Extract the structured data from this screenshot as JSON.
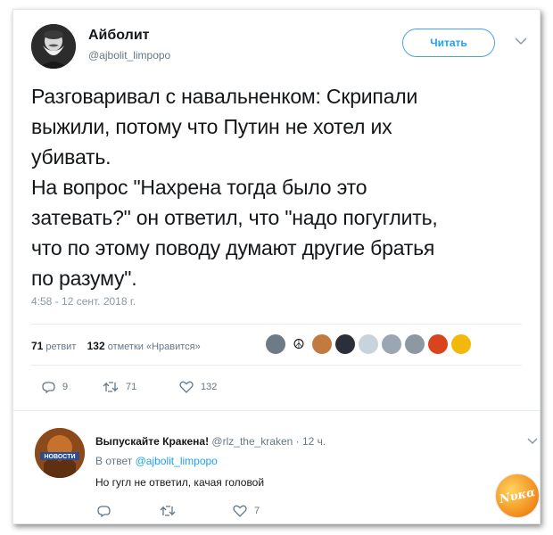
{
  "tweet": {
    "author_name": "Айболит",
    "author_handle": "@ajbolit_limpopo",
    "follow_label": "Читать",
    "text": "Разговаривал с навальненком: Скрипали\nвыжили, потому что Путин не хотел их\nубивать.\nНа вопрос \"Нахрена тогда было это\nзатевать?\" он ответил, что \"надо погуглить,\nчто по этому поводу думают другие братья\nпо разуму\".",
    "timestamp": "4:58 - 12 сент. 2018 г.",
    "retweets_count": "71",
    "retweets_label": "ретвит",
    "likes_count": "132",
    "likes_label": "отметки «Нравится»",
    "reply_action_count": "9",
    "retweet_action_count": "71",
    "like_action_count": "132",
    "liker_colors": [
      "#6d7b86",
      "#111111",
      "#c27a3e",
      "#2b2f3a",
      "#c9d3dc",
      "#9aa7b3",
      "#8d98a3",
      "#d9431e",
      "#f2b90c"
    ]
  },
  "reply": {
    "author_name": "Выпускайте Кракена!",
    "author_handle": "@rlz_the_kraken",
    "time": "· 12 ч.",
    "reply_to_prefix": "В ответ",
    "reply_to_handle": "@ajbolit_limpopo",
    "text": "Но гугл не ответил, качая головой",
    "reply_action_count": "",
    "retweet_action_count": "",
    "like_action_count": "7",
    "avatar_label": "НОВОСТИ"
  },
  "watermark": {
    "text": "Νυκα"
  },
  "colors": {
    "accent": "#1da1f2",
    "secondary_text": "#657786",
    "divider": "#e6ecf0"
  }
}
